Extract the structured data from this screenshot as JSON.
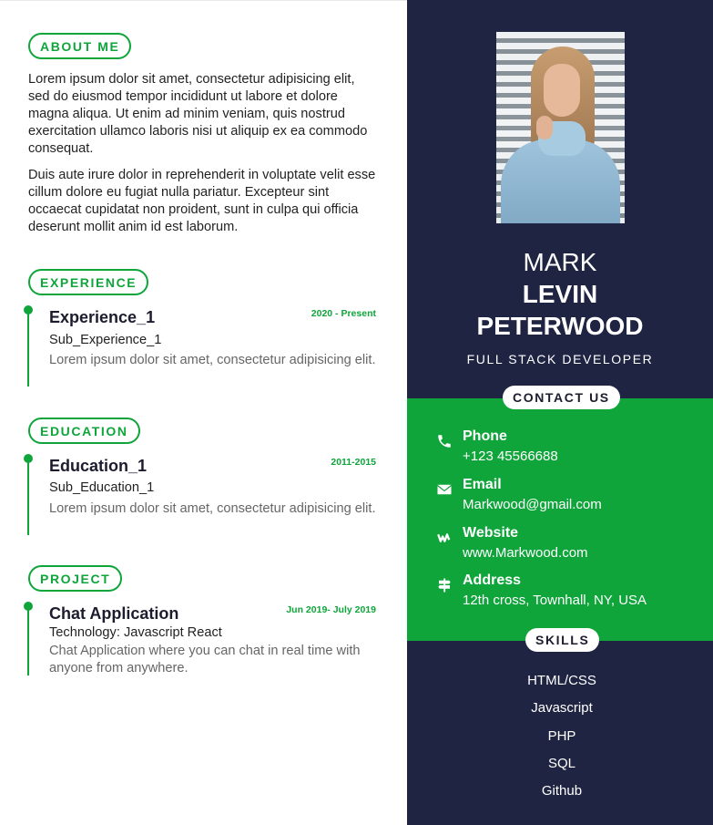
{
  "left": {
    "about": {
      "heading": "ABOUT ME",
      "para1": "Lorem ipsum dolor sit amet, consectetur adipisicing elit, sed do eiusmod tempor incididunt ut labore et dolore magna aliqua. Ut enim ad minim veniam, quis nostrud exercitation ullamco laboris nisi ut aliquip ex ea commodo consequat.",
      "para2": "Duis aute irure dolor in reprehenderit in voluptate velit esse cillum dolore eu fugiat nulla pariatur. Excepteur sint occaecat cupidatat non proident, sunt in culpa qui officia deserunt mollit anim id est laborum."
    },
    "experience": {
      "heading": "EXPERIENCE",
      "title": "Experience_1",
      "date": "2020 - Present",
      "sub": "Sub_Experience_1",
      "desc": "Lorem ipsum dolor sit amet, consectetur adipisicing elit."
    },
    "education": {
      "heading": "EDUCATION",
      "title": "Education_1",
      "date": "2011-2015",
      "sub": "Sub_Education_1",
      "desc": "Lorem ipsum dolor sit amet, consectetur adipisicing elit."
    },
    "project": {
      "heading": "PROJECT",
      "title": "Chat Application",
      "date": "Jun 2019- July 2019",
      "sub": "Technology: Javascript React",
      "desc": "Chat Application where you can chat in real time with anyone from anywhere."
    }
  },
  "right": {
    "name_first": "MARK",
    "name_middle": "LEVIN",
    "name_last": "PETERWOOD",
    "role": "FULL STACK DEVELOPER",
    "contact_heading": "CONTACT US",
    "contacts": [
      {
        "label": "Phone",
        "value": "+123 45566688",
        "icon": "phone-icon"
      },
      {
        "label": "Email",
        "value": "Markwood@gmail.com",
        "icon": "envelope-icon"
      },
      {
        "label": "Website",
        "value": "www.Markwood.com",
        "icon": "weebly-icon"
      },
      {
        "label": "Address",
        "value": "12th cross, Townhall, NY, USA",
        "icon": "signpost-icon"
      }
    ],
    "skills_heading": "SKILLS",
    "skills": [
      "HTML/CSS",
      "Javascript",
      "PHP",
      "SQL",
      "Github"
    ]
  },
  "colors": {
    "accent": "#0fa53b",
    "sidebar": "#1f2442"
  }
}
